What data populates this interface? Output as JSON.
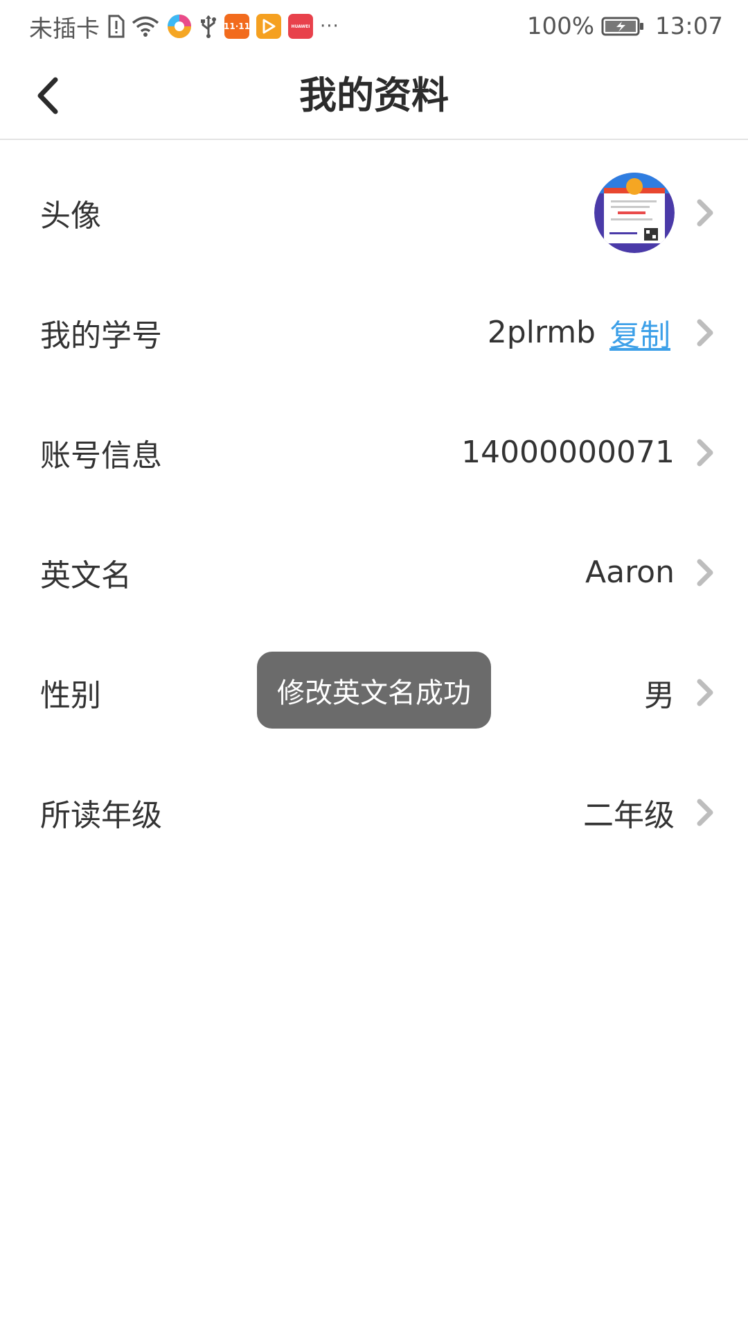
{
  "status_bar": {
    "carrier": "未插卡",
    "battery": "100%",
    "time": "13:07",
    "icons": [
      "sim-alert-icon",
      "wifi-icon",
      "browser-app-icon",
      "usb-icon",
      "shopping-app-icon",
      "video-app-icon",
      "huawei-appgallery-icon",
      "more-notifications-icon"
    ],
    "app_badge_1111": "11·11",
    "app_badge_huawei": "HUAWEI",
    "more": "···"
  },
  "header": {
    "title": "我的资料",
    "back_icon": "chevron-left-icon"
  },
  "profile": {
    "rows": [
      {
        "label": "头像",
        "type": "avatar"
      },
      {
        "label": "我的学号",
        "value": "2plrmb",
        "action": "复制"
      },
      {
        "label": "账号信息",
        "value": "14000000071"
      },
      {
        "label": "英文名",
        "value": "Aaron"
      },
      {
        "label": "性别",
        "value": "男"
      },
      {
        "label": "所读年级",
        "value": "二年级"
      }
    ]
  },
  "toast": {
    "message": "修改英文名成功"
  },
  "colors": {
    "link": "#3da0e8",
    "toast_bg": "#6b6b6b",
    "chevron": "#bdbdbd",
    "divider": "#e3e3e3"
  }
}
